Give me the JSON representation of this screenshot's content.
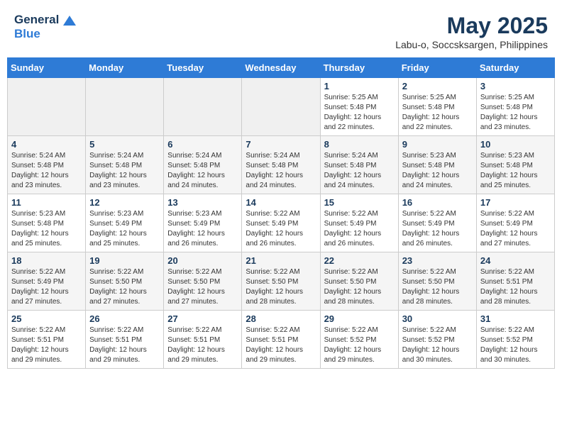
{
  "header": {
    "logo_line1": "General",
    "logo_line2": "Blue",
    "month_title": "May 2025",
    "location": "Labu-o, Soccsksargen, Philippines"
  },
  "weekdays": [
    "Sunday",
    "Monday",
    "Tuesday",
    "Wednesday",
    "Thursday",
    "Friday",
    "Saturday"
  ],
  "weeks": [
    [
      {
        "day": "",
        "info": ""
      },
      {
        "day": "",
        "info": ""
      },
      {
        "day": "",
        "info": ""
      },
      {
        "day": "",
        "info": ""
      },
      {
        "day": "1",
        "info": "Sunrise: 5:25 AM\nSunset: 5:48 PM\nDaylight: 12 hours\nand 22 minutes."
      },
      {
        "day": "2",
        "info": "Sunrise: 5:25 AM\nSunset: 5:48 PM\nDaylight: 12 hours\nand 22 minutes."
      },
      {
        "day": "3",
        "info": "Sunrise: 5:25 AM\nSunset: 5:48 PM\nDaylight: 12 hours\nand 23 minutes."
      }
    ],
    [
      {
        "day": "4",
        "info": "Sunrise: 5:24 AM\nSunset: 5:48 PM\nDaylight: 12 hours\nand 23 minutes."
      },
      {
        "day": "5",
        "info": "Sunrise: 5:24 AM\nSunset: 5:48 PM\nDaylight: 12 hours\nand 23 minutes."
      },
      {
        "day": "6",
        "info": "Sunrise: 5:24 AM\nSunset: 5:48 PM\nDaylight: 12 hours\nand 24 minutes."
      },
      {
        "day": "7",
        "info": "Sunrise: 5:24 AM\nSunset: 5:48 PM\nDaylight: 12 hours\nand 24 minutes."
      },
      {
        "day": "8",
        "info": "Sunrise: 5:24 AM\nSunset: 5:48 PM\nDaylight: 12 hours\nand 24 minutes."
      },
      {
        "day": "9",
        "info": "Sunrise: 5:23 AM\nSunset: 5:48 PM\nDaylight: 12 hours\nand 24 minutes."
      },
      {
        "day": "10",
        "info": "Sunrise: 5:23 AM\nSunset: 5:48 PM\nDaylight: 12 hours\nand 25 minutes."
      }
    ],
    [
      {
        "day": "11",
        "info": "Sunrise: 5:23 AM\nSunset: 5:48 PM\nDaylight: 12 hours\nand 25 minutes."
      },
      {
        "day": "12",
        "info": "Sunrise: 5:23 AM\nSunset: 5:49 PM\nDaylight: 12 hours\nand 25 minutes."
      },
      {
        "day": "13",
        "info": "Sunrise: 5:23 AM\nSunset: 5:49 PM\nDaylight: 12 hours\nand 26 minutes."
      },
      {
        "day": "14",
        "info": "Sunrise: 5:22 AM\nSunset: 5:49 PM\nDaylight: 12 hours\nand 26 minutes."
      },
      {
        "day": "15",
        "info": "Sunrise: 5:22 AM\nSunset: 5:49 PM\nDaylight: 12 hours\nand 26 minutes."
      },
      {
        "day": "16",
        "info": "Sunrise: 5:22 AM\nSunset: 5:49 PM\nDaylight: 12 hours\nand 26 minutes."
      },
      {
        "day": "17",
        "info": "Sunrise: 5:22 AM\nSunset: 5:49 PM\nDaylight: 12 hours\nand 27 minutes."
      }
    ],
    [
      {
        "day": "18",
        "info": "Sunrise: 5:22 AM\nSunset: 5:49 PM\nDaylight: 12 hours\nand 27 minutes."
      },
      {
        "day": "19",
        "info": "Sunrise: 5:22 AM\nSunset: 5:50 PM\nDaylight: 12 hours\nand 27 minutes."
      },
      {
        "day": "20",
        "info": "Sunrise: 5:22 AM\nSunset: 5:50 PM\nDaylight: 12 hours\nand 27 minutes."
      },
      {
        "day": "21",
        "info": "Sunrise: 5:22 AM\nSunset: 5:50 PM\nDaylight: 12 hours\nand 28 minutes."
      },
      {
        "day": "22",
        "info": "Sunrise: 5:22 AM\nSunset: 5:50 PM\nDaylight: 12 hours\nand 28 minutes."
      },
      {
        "day": "23",
        "info": "Sunrise: 5:22 AM\nSunset: 5:50 PM\nDaylight: 12 hours\nand 28 minutes."
      },
      {
        "day": "24",
        "info": "Sunrise: 5:22 AM\nSunset: 5:51 PM\nDaylight: 12 hours\nand 28 minutes."
      }
    ],
    [
      {
        "day": "25",
        "info": "Sunrise: 5:22 AM\nSunset: 5:51 PM\nDaylight: 12 hours\nand 29 minutes."
      },
      {
        "day": "26",
        "info": "Sunrise: 5:22 AM\nSunset: 5:51 PM\nDaylight: 12 hours\nand 29 minutes."
      },
      {
        "day": "27",
        "info": "Sunrise: 5:22 AM\nSunset: 5:51 PM\nDaylight: 12 hours\nand 29 minutes."
      },
      {
        "day": "28",
        "info": "Sunrise: 5:22 AM\nSunset: 5:51 PM\nDaylight: 12 hours\nand 29 minutes."
      },
      {
        "day": "29",
        "info": "Sunrise: 5:22 AM\nSunset: 5:52 PM\nDaylight: 12 hours\nand 29 minutes."
      },
      {
        "day": "30",
        "info": "Sunrise: 5:22 AM\nSunset: 5:52 PM\nDaylight: 12 hours\nand 30 minutes."
      },
      {
        "day": "31",
        "info": "Sunrise: 5:22 AM\nSunset: 5:52 PM\nDaylight: 12 hours\nand 30 minutes."
      }
    ]
  ]
}
